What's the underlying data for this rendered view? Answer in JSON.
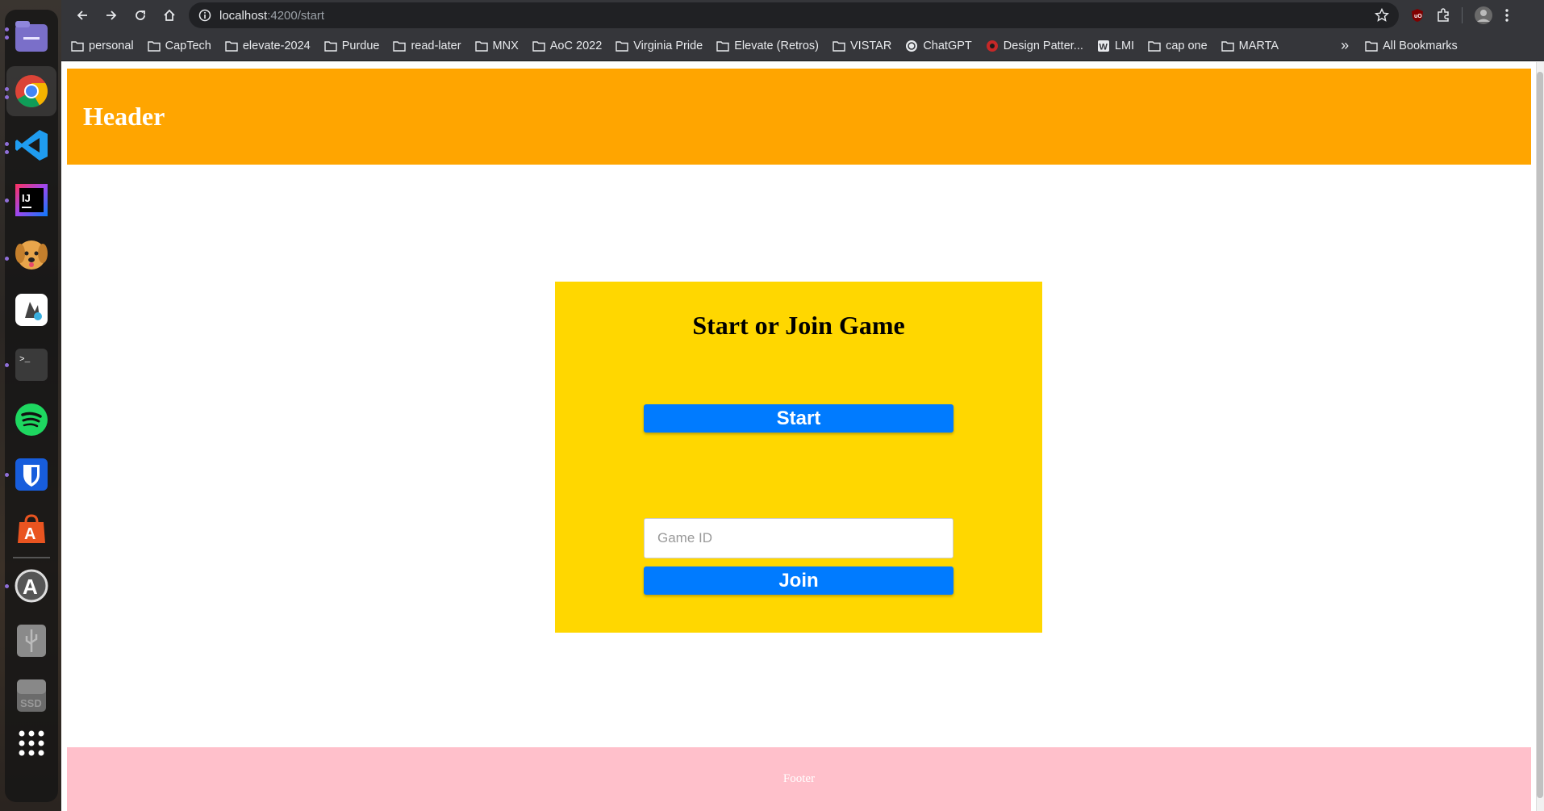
{
  "browser": {
    "url_host": "localhost",
    "url_path": ":4200/start",
    "bookmarks": [
      {
        "label": "personal",
        "icon": "folder-icon"
      },
      {
        "label": "CapTech",
        "icon": "folder-icon"
      },
      {
        "label": "elevate-2024",
        "icon": "folder-icon"
      },
      {
        "label": "Purdue",
        "icon": "folder-icon"
      },
      {
        "label": "read-later",
        "icon": "folder-icon"
      },
      {
        "label": "MNX",
        "icon": "folder-icon"
      },
      {
        "label": "AoC 2022",
        "icon": "folder-icon"
      },
      {
        "label": "Virginia Pride",
        "icon": "folder-icon"
      },
      {
        "label": "Elevate (Retros)",
        "icon": "folder-icon"
      },
      {
        "label": "VISTAR",
        "icon": "folder-icon"
      },
      {
        "label": "ChatGPT",
        "icon": "chatgpt-icon"
      },
      {
        "label": "Design Patter...",
        "icon": "site-icon"
      },
      {
        "label": "LMI",
        "icon": "w-icon"
      },
      {
        "label": "cap one",
        "icon": "folder-icon"
      },
      {
        "label": "MARTA",
        "icon": "folder-icon"
      }
    ],
    "more_label": "»",
    "all_bookmarks": "All Bookmarks"
  },
  "dock": {
    "apps": [
      "files-icon",
      "chrome-icon",
      "vscode-icon",
      "intellij-icon",
      "dog-icon",
      "app-icon",
      "terminal-icon",
      "spotify-icon",
      "bitwarden-icon",
      "app-center-icon",
      "updater-icon",
      "usb-icon",
      "ssd-icon",
      "app-grid-icon"
    ],
    "ssd_label": "SSD"
  },
  "page": {
    "header_title": "Header",
    "card_title": "Start or Join Game",
    "start_label": "Start",
    "game_id_placeholder": "Game ID",
    "game_id_value": "",
    "join_label": "Join",
    "footer_text": "Footer"
  },
  "colors": {
    "header": "#ffa500",
    "card": "#ffd700",
    "button": "#007bff",
    "footer": "#ffc0cb"
  }
}
